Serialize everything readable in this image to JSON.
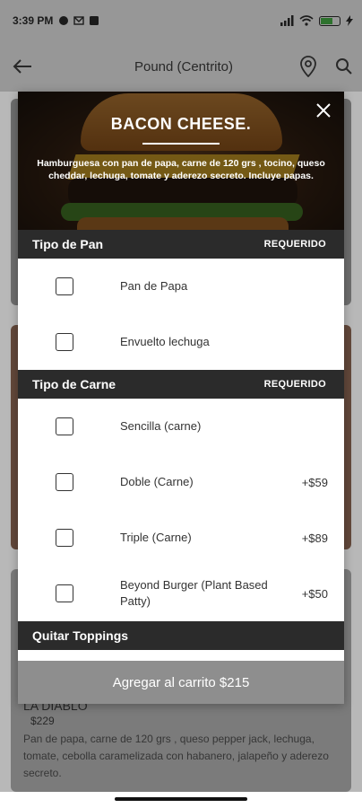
{
  "status": {
    "time": "3:39 PM",
    "battery": "95"
  },
  "header": {
    "title": "Pound (Centrito)"
  },
  "background_item": {
    "name": "LA DIABLO",
    "price": "$229",
    "description": "Pan de papa, carne de 120 grs , queso pepper jack, lechuga, tomate, cebolla caramelizada con habanero, jalapeño y aderezo secreto."
  },
  "modal": {
    "title": "BACON CHEESE.",
    "description": "Hamburguesa con pan de papa, carne de 120 grs , tocino, queso cheddar, lechuga, tomate y aderezo secreto. Incluye papas.",
    "sections": [
      {
        "title": "Tipo de Pan",
        "badge": "REQUERIDO",
        "options": [
          {
            "label": "Pan de Papa",
            "price": ""
          },
          {
            "label": "Envuelto lechuga",
            "price": ""
          }
        ]
      },
      {
        "title": "Tipo de Carne",
        "badge": "REQUERIDO",
        "options": [
          {
            "label": "Sencilla (carne)",
            "price": ""
          },
          {
            "label": "Doble (Carne)",
            "price": "+$59"
          },
          {
            "label": "Triple (Carne)",
            "price": "+$89"
          },
          {
            "label": "Beyond Burger (Plant Based Patty)",
            "price": "+$50"
          }
        ]
      },
      {
        "title": "Quitar Toppings",
        "badge": ""
      }
    ]
  },
  "cta": {
    "label": "Agregar al carrito $215"
  }
}
